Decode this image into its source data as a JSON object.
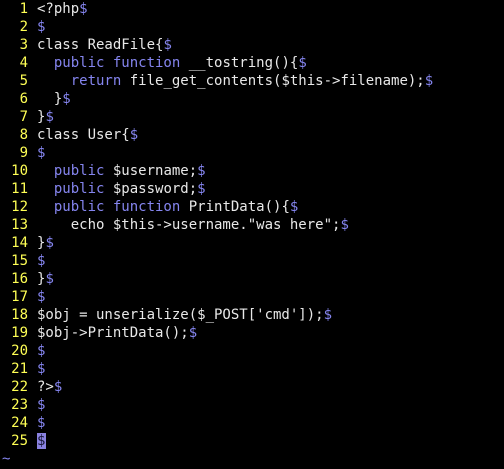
{
  "editor": {
    "colors": {
      "background": "#000000",
      "line_number": "#ffff55",
      "text": "#e8e8e8",
      "keyword": "#8585ef",
      "eol_marker": "#8585ef",
      "cursor": "#8a82e0"
    },
    "eol_marker": "$",
    "empty_line_marker": "~",
    "lines": [
      {
        "num": "1",
        "segments": [
          {
            "t": "<?php",
            "k": "default"
          }
        ]
      },
      {
        "num": "2",
        "segments": []
      },
      {
        "num": "3",
        "segments": [
          {
            "t": "class ReadFile{",
            "k": "default"
          }
        ]
      },
      {
        "num": "4",
        "segments": [
          {
            "t": "  ",
            "k": "default"
          },
          {
            "t": "public function",
            "k": "keyword"
          },
          {
            "t": " __tostring(){",
            "k": "default"
          }
        ]
      },
      {
        "num": "5",
        "segments": [
          {
            "t": "    ",
            "k": "default"
          },
          {
            "t": "return",
            "k": "keyword"
          },
          {
            "t": " file_get_contents($this->filename);",
            "k": "default"
          }
        ]
      },
      {
        "num": "6",
        "segments": [
          {
            "t": "  }",
            "k": "default"
          }
        ]
      },
      {
        "num": "7",
        "segments": [
          {
            "t": "}",
            "k": "default"
          }
        ]
      },
      {
        "num": "8",
        "segments": [
          {
            "t": "class User{",
            "k": "default"
          }
        ]
      },
      {
        "num": "9",
        "segments": []
      },
      {
        "num": "10",
        "segments": [
          {
            "t": "  ",
            "k": "default"
          },
          {
            "t": "public",
            "k": "keyword"
          },
          {
            "t": " $username;",
            "k": "default"
          }
        ]
      },
      {
        "num": "11",
        "segments": [
          {
            "t": "  ",
            "k": "default"
          },
          {
            "t": "public",
            "k": "keyword"
          },
          {
            "t": " $password;",
            "k": "default"
          }
        ]
      },
      {
        "num": "12",
        "segments": [
          {
            "t": "  ",
            "k": "default"
          },
          {
            "t": "public function",
            "k": "keyword"
          },
          {
            "t": " PrintData(){",
            "k": "default"
          }
        ]
      },
      {
        "num": "13",
        "segments": [
          {
            "t": "    echo $this->username.\"was here\";",
            "k": "default"
          }
        ]
      },
      {
        "num": "14",
        "segments": [
          {
            "t": "}",
            "k": "default"
          }
        ]
      },
      {
        "num": "15",
        "segments": []
      },
      {
        "num": "16",
        "segments": [
          {
            "t": "}",
            "k": "default"
          }
        ]
      },
      {
        "num": "17",
        "segments": []
      },
      {
        "num": "18",
        "segments": [
          {
            "t": "$obj = unserialize($_POST['cmd']);",
            "k": "default"
          }
        ]
      },
      {
        "num": "19",
        "segments": [
          {
            "t": "$obj->PrintData();",
            "k": "default"
          }
        ]
      },
      {
        "num": "20",
        "segments": []
      },
      {
        "num": "21",
        "segments": []
      },
      {
        "num": "22",
        "segments": [
          {
            "t": "?>",
            "k": "default"
          }
        ]
      },
      {
        "num": "23",
        "segments": []
      },
      {
        "num": "24",
        "segments": []
      },
      {
        "num": "25",
        "segments": [],
        "cursor": true
      }
    ]
  }
}
